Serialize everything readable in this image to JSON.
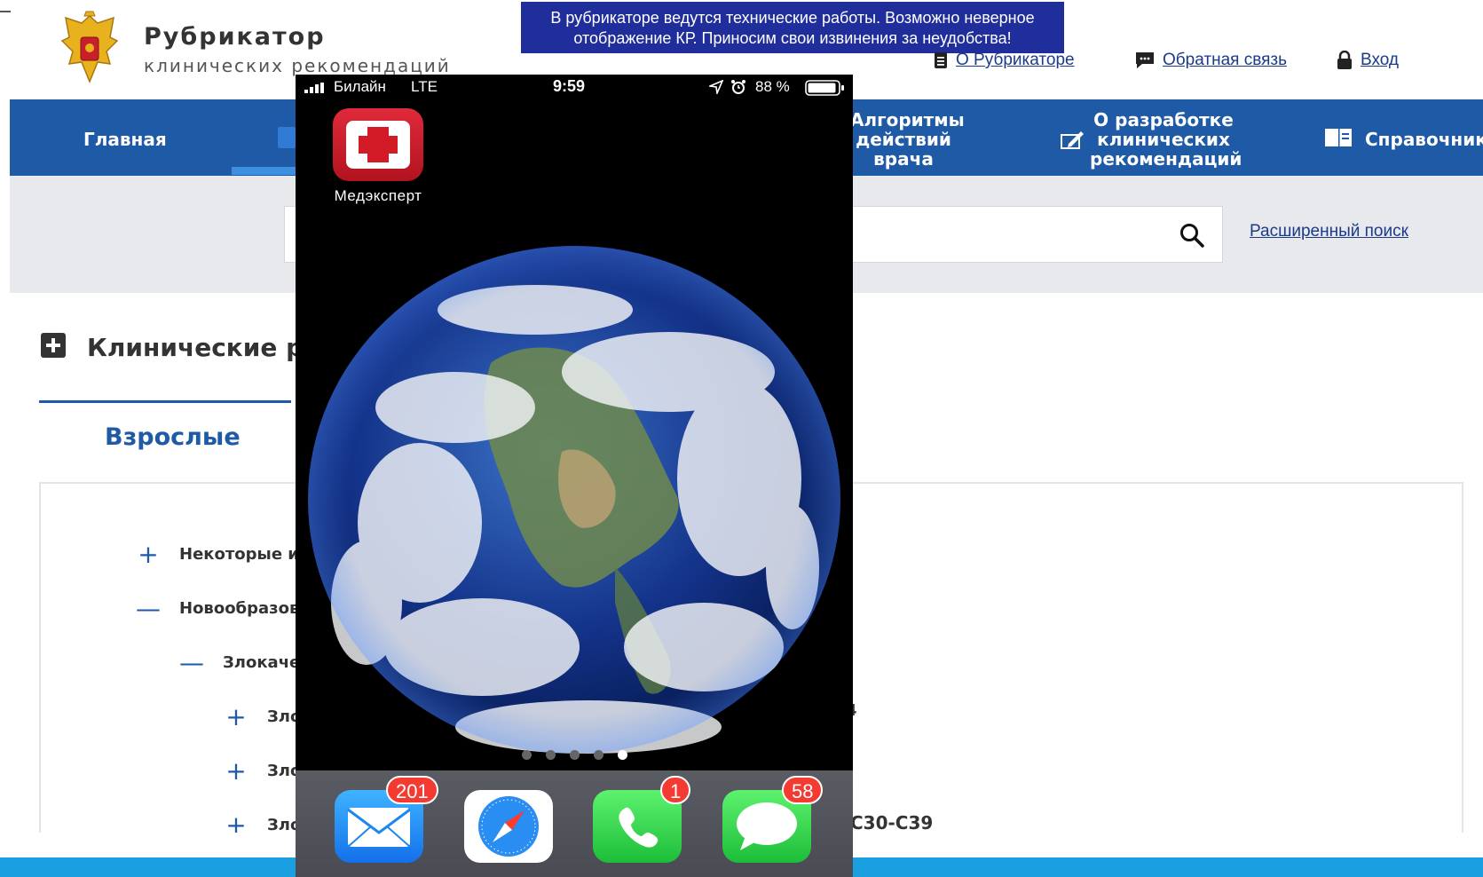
{
  "site": {
    "title": "Рубрикатор",
    "subtitle": "клинических рекомендаций",
    "notice_line1": "В рубрикаторе ведутся технические работы. Возможно неверное",
    "notice_line2": "отображение КР. Приносим свои извинения за неудобства!"
  },
  "toplinks": {
    "about": "О Рубрикаторе",
    "feedback": "Обратная связь",
    "login": "Вход"
  },
  "nav": {
    "home": "Главная",
    "algorithms_1": "Алгоритмы",
    "algorithms_2": "действий",
    "algorithms_3": "врача",
    "dev_1": "О разработке",
    "dev_2": "клинических",
    "dev_3": "рекомендаций",
    "reference": "Справочники"
  },
  "search": {
    "advanced_label": "Расширенный поиск"
  },
  "section": {
    "title": "Клинические рек",
    "tab_adults": "Взрослые"
  },
  "tree": [
    {
      "sign": "+",
      "label": "Некоторые ин"
    },
    {
      "sign": "—",
      "label": "Новообразова"
    },
    {
      "sign": "—",
      "label": "Злокаче"
    },
    {
      "sign": "+",
      "label": "Зло"
    },
    {
      "sign": "+",
      "label": "Зло"
    },
    {
      "sign": "+",
      "label": "Зло"
    }
  ],
  "peek": {
    "right_fragment": "4",
    "code_fragment": "С30-С39"
  },
  "phone": {
    "carrier": "Билайн",
    "network": "LTE",
    "time": "9:59",
    "battery": "88 %",
    "app_label": "Медэксперт",
    "page_count": 5,
    "active_page": 5,
    "dock": {
      "mail_badge": "201",
      "phone_badge": "1",
      "messages_badge": "58"
    }
  },
  "colors": {
    "nav_blue": "#1e5aa6",
    "notice_bg": "#1f2e9b",
    "footer_blue": "#1aa0e0",
    "badge_red": "#f43b31"
  }
}
